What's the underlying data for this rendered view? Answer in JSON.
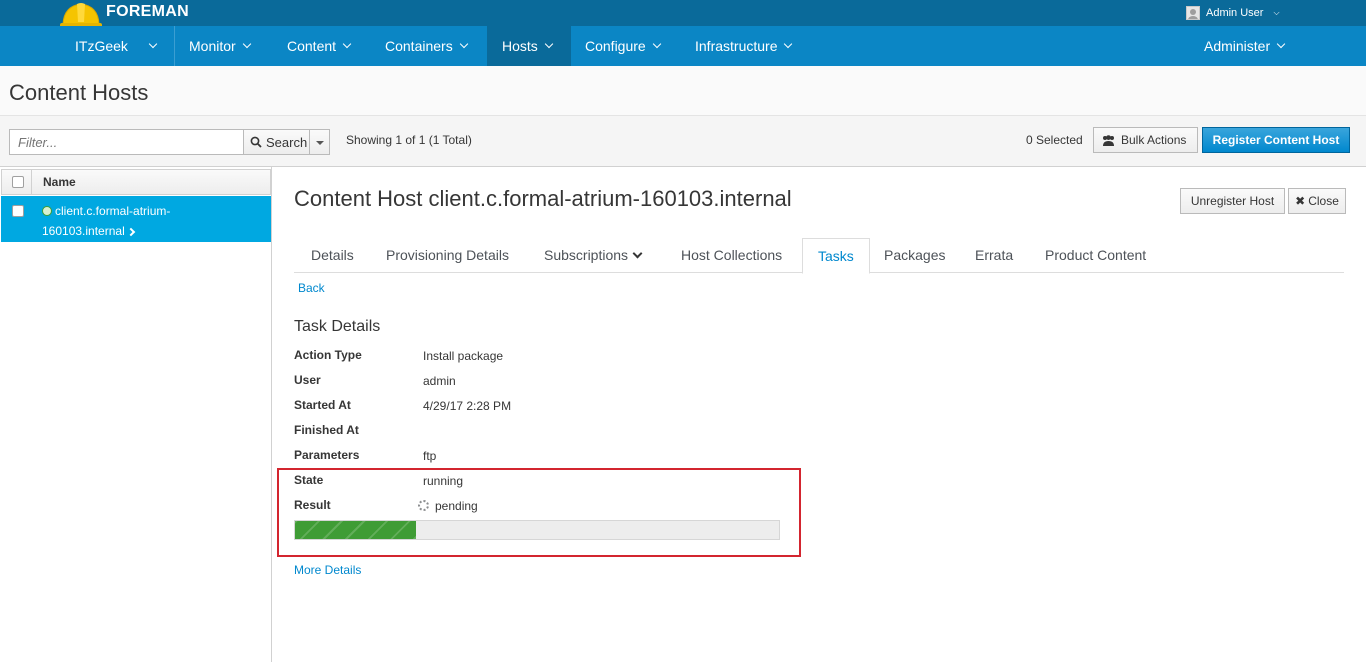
{
  "brand": {
    "name": "FOREMAN"
  },
  "user_menu": {
    "label": "Admin User"
  },
  "nav": {
    "org": "ITzGeek",
    "items": [
      "Monitor",
      "Content",
      "Containers",
      "Hosts",
      "Configure",
      "Infrastructure"
    ],
    "active": "Hosts",
    "admin": "Administer"
  },
  "page": {
    "title": "Content Hosts"
  },
  "toolbar": {
    "filter_placeholder": "Filter...",
    "search_label": "Search",
    "showing": "Showing 1 of 1 (1 Total)",
    "selected": "0 Selected",
    "bulk_actions": "Bulk Actions",
    "register": "Register Content Host"
  },
  "list": {
    "column_name": "Name",
    "rows": [
      {
        "line1": "client.c.formal-atrium-",
        "line2": "160103.internal",
        "selected": true
      }
    ]
  },
  "detail": {
    "title": "Content Host client.c.formal-atrium-160103.internal",
    "unregister": "Unregister Host",
    "close": "Close",
    "tabs": [
      "Details",
      "Provisioning Details",
      "Subscriptions",
      "Host Collections",
      "Tasks",
      "Packages",
      "Errata",
      "Product Content"
    ],
    "active_tab": "Tasks",
    "back": "Back",
    "task_title": "Task Details",
    "fields": [
      {
        "label": "Action Type",
        "value": "Install package"
      },
      {
        "label": "User",
        "value": "admin"
      },
      {
        "label": "Started At",
        "value": "4/29/17 2:28 PM"
      },
      {
        "label": "Finished At",
        "value": ""
      },
      {
        "label": "Parameters",
        "value": "ftp"
      },
      {
        "label": "State",
        "value": "running"
      },
      {
        "label": "Result",
        "value": "pending"
      }
    ],
    "progress_fraction": 0.25,
    "more_details": "More Details"
  },
  "colors": {
    "brand_bar": "#0a6a9a",
    "nav_bar": "#0b86c5",
    "selected_row": "#00a8e1",
    "primary_button": "#0088ce",
    "progress": "#3f9c35",
    "highlight": "#d3252f"
  },
  "icons": [
    "hard-hat-logo",
    "user-avatar-icon",
    "search-icon",
    "users-icon",
    "check-circle-icon",
    "chevron-right-icon",
    "close-icon",
    "spinner-icon"
  ]
}
